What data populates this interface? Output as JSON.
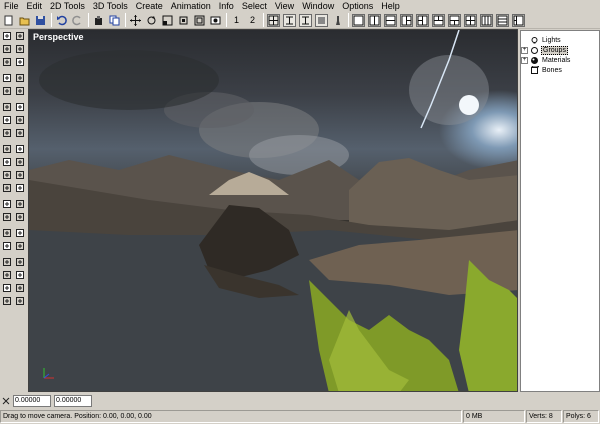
{
  "menubar": {
    "items": [
      "File",
      "Edit",
      "2D Tools",
      "3D Tools",
      "Create",
      "Animation",
      "Info",
      "Select",
      "View",
      "Window",
      "Options",
      "Help"
    ]
  },
  "toolbar": {
    "buttons": [
      {
        "icon": "select-rect-icon"
      },
      {
        "icon": "open-folder-icon"
      },
      {
        "icon": "save-icon"
      },
      {
        "icon": "undo-icon"
      },
      {
        "icon": "redo-icon"
      },
      {
        "icon": "cut-icon"
      },
      {
        "icon": "copy-icon"
      },
      {
        "icon": "move-icon"
      },
      {
        "icon": "rotate-icon"
      },
      {
        "icon": "scale-icon"
      },
      {
        "icon": "frame-icon"
      },
      {
        "icon": "frame-all-icon"
      },
      {
        "icon": "render-icon"
      }
    ],
    "view_buttons": [
      "1",
      "2"
    ]
  },
  "viewport": {
    "label": "Perspective",
    "axis_colors": {
      "x": "#d03030",
      "y": "#30c030",
      "z": "#3050e0"
    }
  },
  "tree": {
    "items": [
      {
        "label": "Lights",
        "icon": "light-bulb-icon",
        "expander": false,
        "selected": false
      },
      {
        "label": "Groups",
        "icon": "group-icon",
        "expander": true,
        "selected": true
      },
      {
        "label": "Materials",
        "icon": "sphere-icon",
        "expander": true,
        "selected": false
      },
      {
        "label": "Bones",
        "icon": "bone-icon",
        "expander": false,
        "selected": false
      }
    ]
  },
  "coords": {
    "x_value": "0.00000",
    "y_value": "0.00000"
  },
  "status": {
    "message": "Drag to move camera. Position: 0.00, 0.00, 0.00",
    "memory": "0 MB",
    "verts": "Verts: 8",
    "polys": "Polys: 6"
  },
  "colors": {
    "chrome": "#d4d0c8",
    "selection": "#d4d0c8"
  }
}
